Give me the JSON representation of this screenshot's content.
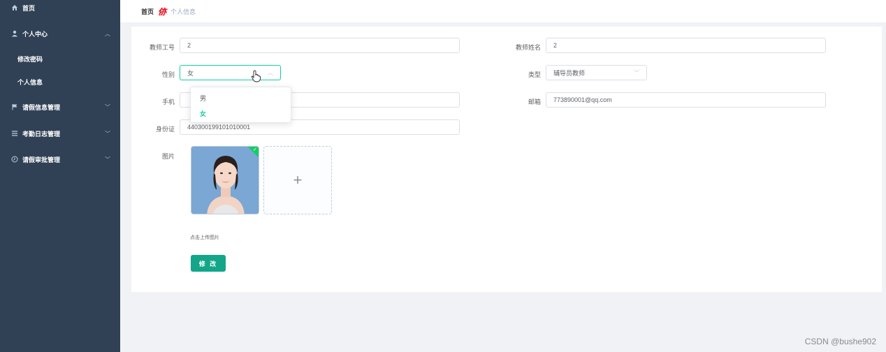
{
  "sidebar": {
    "items": [
      {
        "label": "首页",
        "icon": "home-icon"
      },
      {
        "label": "个人中心",
        "icon": "user-icon",
        "expanded": true
      },
      {
        "label": "修改密码",
        "sub": true
      },
      {
        "label": "个人信息",
        "sub": true
      },
      {
        "label": "请假信息管理",
        "icon": "flag-icon"
      },
      {
        "label": "考勤日志管理",
        "icon": "list-icon"
      },
      {
        "label": "请假审批管理",
        "icon": "clock-icon"
      }
    ]
  },
  "breadcrumb": {
    "home": "首页",
    "separator": "㑊",
    "current": "个人信息"
  },
  "form": {
    "teacher_no_label": "教师工号",
    "teacher_no_value": "2",
    "teacher_name_label": "教师姓名",
    "teacher_name_value": "2",
    "gender_label": "性别",
    "gender_value": "女",
    "type_label": "类型",
    "type_value": "辅导员教师",
    "phone_label": "手机",
    "email_label": "邮箱",
    "email_value": "773890001@qq.com",
    "id_label": "身份证",
    "id_value": "440300199101010001",
    "photo_label": "图片",
    "upload_hint": "点击上传图片",
    "submit_label": "修 改"
  },
  "gender_options": [
    "男",
    "女"
  ],
  "selected_gender_index": 1,
  "watermark": "CSDN @bushe902",
  "colors": {
    "sidebar": "#304156",
    "accent": "#13a689",
    "select_focus": "#13ce9a"
  }
}
